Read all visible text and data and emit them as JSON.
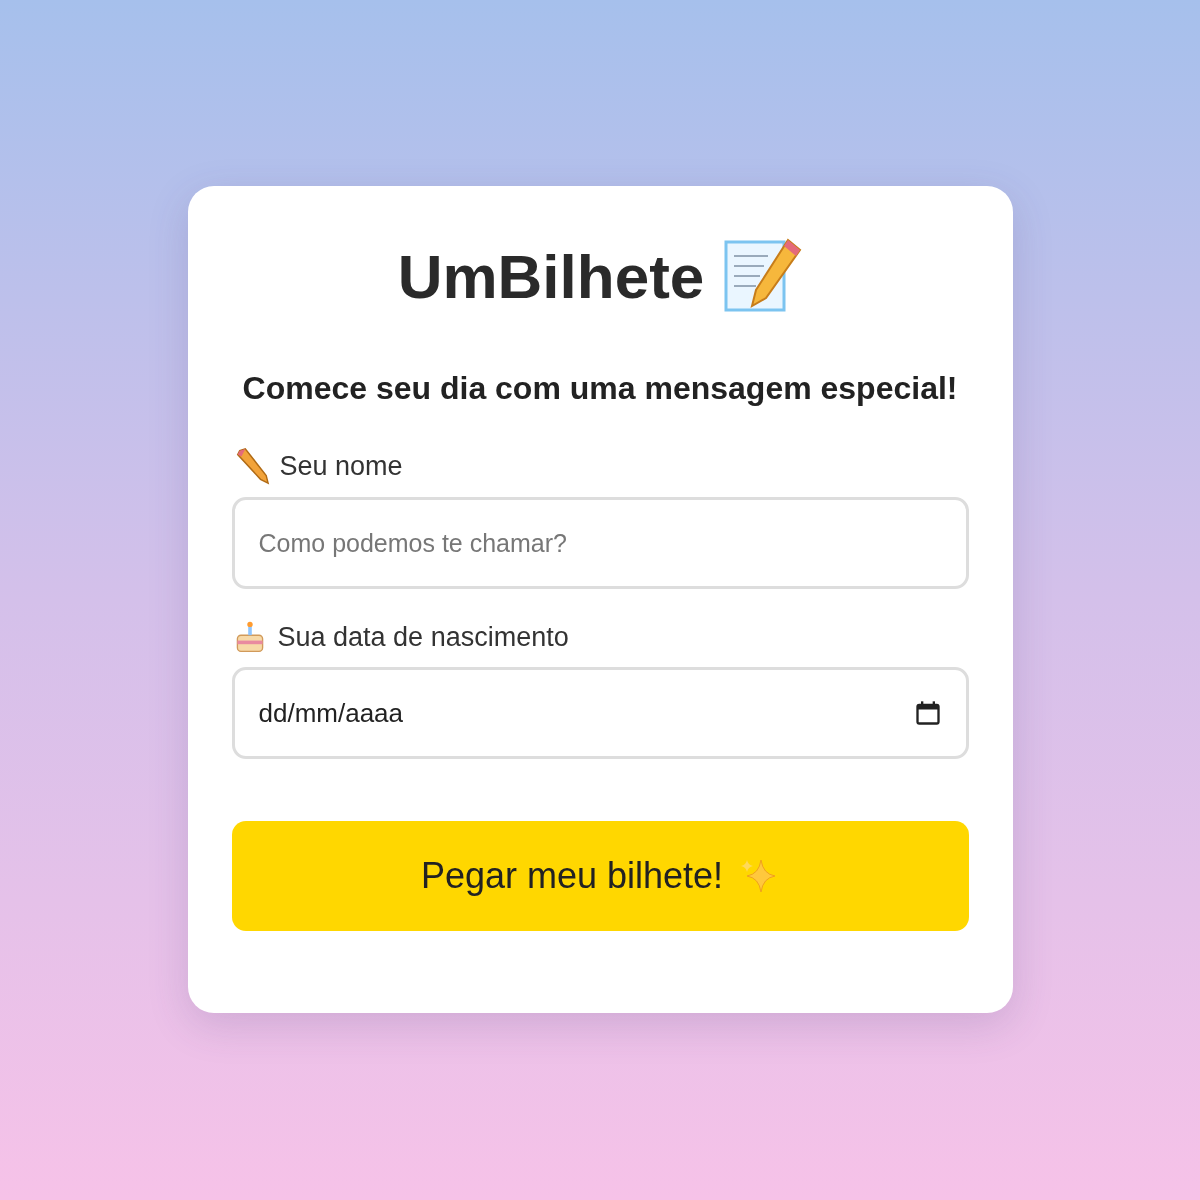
{
  "card": {
    "title": "UmBilhete",
    "subtitle": "Comece seu dia com uma mensagem especial!",
    "fields": [
      {
        "kind": "text",
        "label": "Seu nome",
        "placeholder": "Como podemos te chamar?"
      },
      {
        "kind": "date",
        "label": "Sua data de nascimento",
        "placeholder": "dd/mm/aaaa"
      }
    ],
    "button": "Pegar meu bilhete!"
  }
}
